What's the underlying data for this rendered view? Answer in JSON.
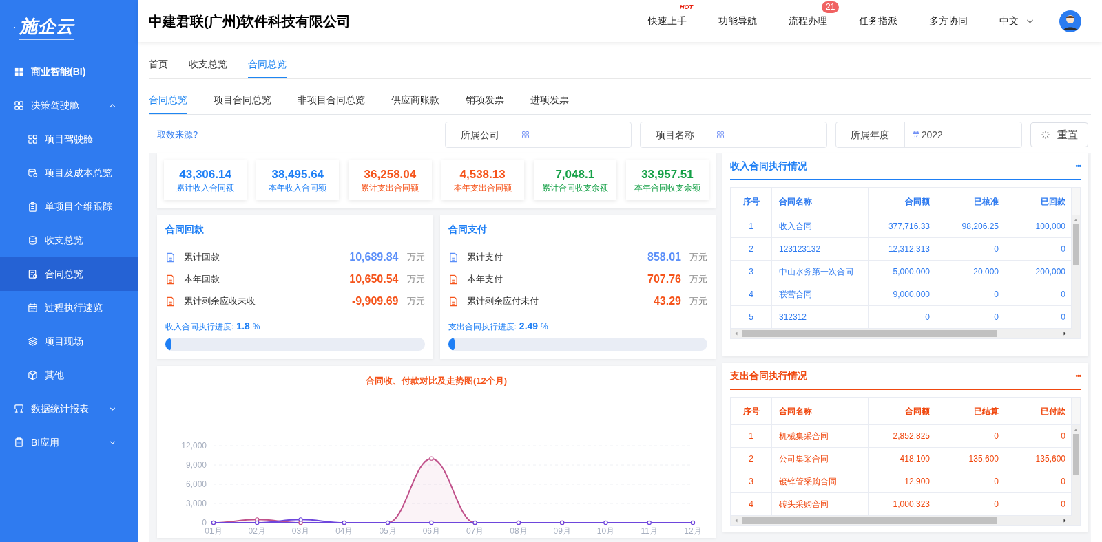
{
  "sidebar": {
    "logo": "施企云",
    "items": [
      {
        "kind": "title",
        "label": "商业智能(BI)",
        "selected": false
      },
      {
        "kind": "menu",
        "label": "决策驾驶舱",
        "selected": false,
        "expanded": true,
        "children": [
          {
            "label": "项目驾驶舱",
            "selected": false
          },
          {
            "label": "项目及成本总览",
            "selected": false
          },
          {
            "label": "单项目全维跟踪",
            "selected": false
          },
          {
            "label": "收支总览",
            "selected": false
          },
          {
            "label": "合同总览",
            "selected": true
          },
          {
            "label": "过程执行速览",
            "selected": false
          },
          {
            "label": "项目现场",
            "selected": false
          },
          {
            "label": "其他",
            "selected": false
          }
        ]
      },
      {
        "kind": "menu",
        "label": "数据统计报表",
        "selected": false,
        "expanded": false
      },
      {
        "kind": "menu",
        "label": "BI应用",
        "selected": false,
        "expanded": false
      }
    ]
  },
  "header": {
    "company": "中建君联(广州)软件科技有限公司",
    "nav": [
      {
        "label": "快速上手",
        "hot": "HOT"
      },
      {
        "label": "功能导航"
      },
      {
        "label": "流程办理",
        "badge": "21"
      },
      {
        "label": "任务指派"
      },
      {
        "label": "多方协同"
      }
    ],
    "language": "中文"
  },
  "tabs": [
    {
      "label": "首页",
      "selected": false
    },
    {
      "label": "收支总览",
      "selected": false
    },
    {
      "label": "合同总览",
      "selected": true
    }
  ],
  "subtabs": [
    {
      "label": "合同总览",
      "selected": true
    },
    {
      "label": "项目合同总览",
      "selected": false
    },
    {
      "label": "非项目合同总览",
      "selected": false
    },
    {
      "label": "供应商账款",
      "selected": false
    },
    {
      "label": "销项发票",
      "selected": false
    },
    {
      "label": "进项发票",
      "selected": false
    }
  ],
  "filters": {
    "source_link": "取数来源?",
    "fields": [
      {
        "kind": "select",
        "label": "所属公司"
      },
      {
        "kind": "select",
        "label": "项目名称"
      },
      {
        "kind": "date",
        "label": "所属年度",
        "value": "2022"
      }
    ],
    "reset": "重置"
  },
  "stats": [
    {
      "kind": "income",
      "value": "43,306.14",
      "label": "累计收入合同额"
    },
    {
      "kind": "income",
      "value": "38,495.64",
      "label": "本年收入合同额"
    },
    {
      "kind": "expense",
      "value": "36,258.04",
      "label": "累计支出合同额"
    },
    {
      "kind": "expense",
      "value": "4,538.13",
      "label": "本年支出合同额"
    },
    {
      "kind": "balance",
      "value": "7,048.1",
      "label": "累计合同收支余额"
    },
    {
      "kind": "balance",
      "value": "33,957.51",
      "label": "本年合同收支余额"
    }
  ],
  "summaries": [
    {
      "title": "合同回款",
      "rows": [
        {
          "label": "累计回款",
          "value": "10,689.84",
          "unit": "万元",
          "color": "#5b8ff9"
        },
        {
          "label": "本年回款",
          "value": "10,650.54",
          "unit": "万元",
          "color": "#f5541b"
        },
        {
          "label": "累计剩余应收未收",
          "value": "-9,909.69",
          "unit": "万元",
          "color": "#f5541b"
        }
      ],
      "progress_label": "收入合同执行进度:",
      "progress_value": "1.8",
      "progress_unit": "%",
      "level": 0.018
    },
    {
      "title": "合同支付",
      "rows": [
        {
          "label": "累计支付",
          "value": "858.01",
          "unit": "万元",
          "color": "#5b8ff9"
        },
        {
          "label": "本年支付",
          "value": "707.76",
          "unit": "万元",
          "color": "#f5541b"
        },
        {
          "label": "累计剩余应付未付",
          "value": "43.29",
          "unit": "万元",
          "color": "#f5541b"
        }
      ],
      "progress_label": "支出合同执行进度:",
      "progress_value": "2.49",
      "progress_unit": "%",
      "level": 0.0249
    }
  ],
  "trend": {
    "chart_data": {
      "type": "area",
      "grid": true,
      "title": "合同收、付款对比及走势图(12个月)",
      "categories": [
        "01月",
        "02月",
        "03月",
        "04月",
        "05月",
        "06月",
        "07月",
        "08月",
        "09月",
        "10月",
        "11月",
        "12月"
      ],
      "series": [
        {
          "color": "#c0508a",
          "marker": "circle",
          "values": [
            0,
            500,
            0,
            0,
            0,
            10000,
            0,
            0,
            0,
            null,
            null,
            null
          ]
        },
        {
          "color": "#6e46dc",
          "marker": "circle",
          "values": [
            0,
            0,
            500,
            0,
            0,
            0,
            0,
            0,
            0,
            0,
            0,
            0
          ]
        }
      ],
      "ylim": [
        0,
        12000
      ],
      "yticks": [
        {
          "value": 0,
          "label": "0"
        },
        {
          "value": 3000,
          "label": "3,000"
        },
        {
          "value": 6000,
          "label": "6,000"
        },
        {
          "value": 9000,
          "label": "9,000"
        },
        {
          "value": 12000,
          "label": "12,000"
        }
      ]
    }
  },
  "tables": [
    {
      "kind": "income",
      "title": "收入合同执行情况",
      "more": "•••",
      "columns": [
        "序号",
        "合同名称",
        "合同额",
        "已核准",
        "已回款"
      ],
      "rows": [
        [
          "1",
          "收入合同",
          "377,716.33",
          "98,206.25",
          "100,000"
        ],
        [
          "2",
          "123123132",
          "12,312,313",
          "0",
          "0"
        ],
        [
          "3",
          "中山水务第一次合同",
          "5,000,000",
          "20,000",
          "200,000"
        ],
        [
          "4",
          "联营合同",
          "9,000,000",
          "0",
          "0"
        ],
        [
          "5",
          "312312",
          "0",
          "0",
          "0"
        ]
      ]
    },
    {
      "kind": "expense",
      "title": "支出合同执行情况",
      "more": "•••",
      "columns": [
        "序号",
        "合同名称",
        "合同额",
        "已结算",
        "已付款"
      ],
      "rows": [
        [
          "1",
          "机械集采合同",
          "2,852,825",
          "0",
          "0"
        ],
        [
          "2",
          "公司集采合同",
          "418,100",
          "135,600",
          "135,600"
        ],
        [
          "3",
          "镀锌管采购合同",
          "12,900",
          "0",
          "0"
        ],
        [
          "4",
          "砖头采购合同",
          "1,000,323",
          "0",
          "0"
        ]
      ]
    }
  ]
}
